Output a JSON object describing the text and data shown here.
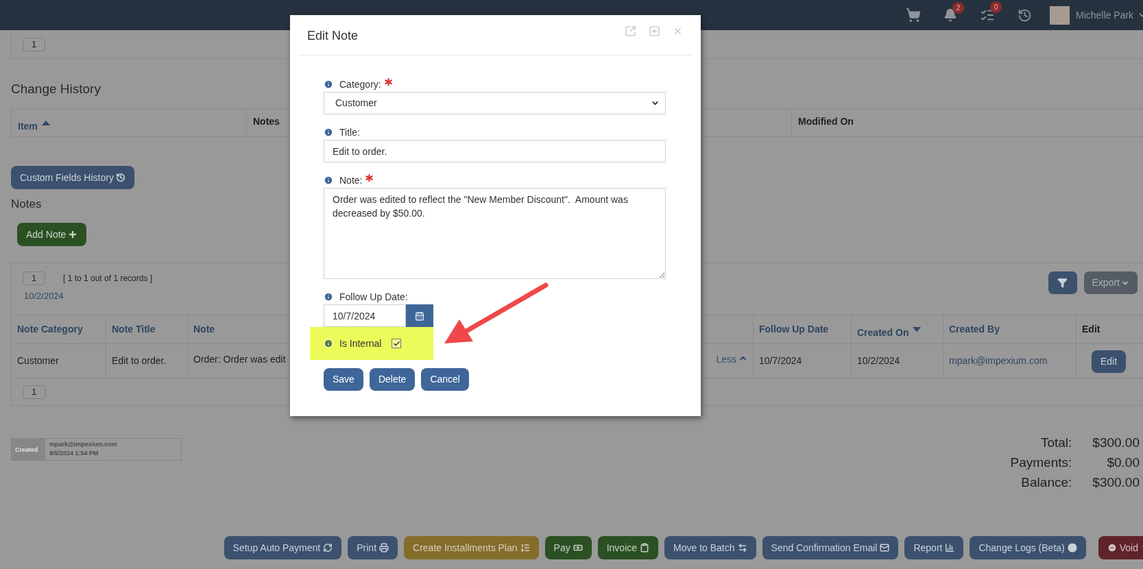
{
  "top_bar": {
    "notifications_count": "2",
    "tasks_count": "0",
    "user_name": "Michelle Park"
  },
  "top_pager": {
    "page": "1"
  },
  "change_history": {
    "title": "Change History",
    "columns": [
      {
        "label": "Item",
        "sortable": true,
        "sorted_ascending": true,
        "sorted_descending": false
      },
      {
        "label": "Notes",
        "sortable": false,
        "sorted_ascending": false,
        "sorted_descending": false
      },
      {
        "label": "Modified On",
        "sortable": false,
        "sorted_ascending": false,
        "sorted_descending": false
      }
    ]
  },
  "custom_fields_button": "Custom Fields History",
  "notes": {
    "title": "Notes",
    "add_button": "Add Note",
    "page": "1",
    "summary": "[ 1 to 1 out of 1 records ]",
    "date": "10/2/2024",
    "export_button": "Export",
    "columns": [
      {
        "label": "Note Category",
        "sortable": true,
        "sorted_ascending": false,
        "sorted_descending": false
      },
      {
        "label": "Note Title",
        "sortable": true,
        "sorted_ascending": false,
        "sorted_descending": false
      },
      {
        "label": "Note",
        "sortable": true,
        "sorted_ascending": false,
        "sorted_descending": false
      },
      {
        "label": "Follow Up Date",
        "sortable": true,
        "sorted_ascending": false,
        "sorted_descending": false
      },
      {
        "label": "Created On",
        "sortable": true,
        "sorted_ascending": false,
        "sorted_descending": true
      },
      {
        "label": "Created By",
        "sortable": true,
        "sorted_ascending": false,
        "sorted_descending": false
      },
      {
        "label": "Edit",
        "sortable": false,
        "sorted_ascending": false,
        "sorted_descending": false
      }
    ],
    "rows": [
      {
        "note_category": "Customer",
        "note_title": "Edit to order.",
        "note": "Order: Order was edit",
        "toggle": "Less",
        "follow_up_date": "10/7/2024",
        "created_on": "10/2/2024",
        "created_by": "mpark@impexium.com",
        "edit_button": "Edit"
      }
    ],
    "footer_page": "1"
  },
  "created_info": {
    "label": "Created",
    "by": "mpark@impexium.com",
    "when": "8/5/2024 1:54 PM"
  },
  "totals": [
    {
      "label": "Total:",
      "value": "$300.00"
    },
    {
      "label": "Payments:",
      "value": "$0.00"
    },
    {
      "label": "Balance:",
      "value": "$300.00"
    }
  ],
  "actions": [
    {
      "label": "Setup Auto Payment",
      "kind": "primary"
    },
    {
      "label": "Print",
      "kind": "primary"
    },
    {
      "label": "Create Installments Plan",
      "kind": "warning"
    },
    {
      "label": "Pay",
      "kind": "success"
    },
    {
      "label": "Invoice",
      "kind": "success"
    },
    {
      "label": "Move to Batch",
      "kind": "primary"
    },
    {
      "label": "Send Confirmation Email",
      "kind": "primary"
    },
    {
      "label": "Report",
      "kind": "primary"
    },
    {
      "label": "Change Logs (Beta)",
      "kind": "primary"
    },
    {
      "label": "Void",
      "kind": "danger"
    }
  ],
  "modal": {
    "title": "Edit Note",
    "fields": [
      {
        "kind": "select",
        "label": "Category:",
        "required": true,
        "value": "Customer"
      },
      {
        "kind": "text",
        "label": "Title:",
        "required": false,
        "value": "Edit to order."
      },
      {
        "kind": "textarea",
        "label": "Note:",
        "required": true,
        "value": "Order was edited to reflect the \"New Member Discount\".  Amount was decreased by $50.00."
      },
      {
        "kind": "date",
        "label": "Follow Up Date:",
        "required": false,
        "value": "10/7/2024"
      },
      {
        "kind": "checkbox",
        "label": "Is Internal",
        "checked": true,
        "highlighted": true
      }
    ],
    "buttons": [
      "Save",
      "Delete",
      "Cancel"
    ]
  }
}
